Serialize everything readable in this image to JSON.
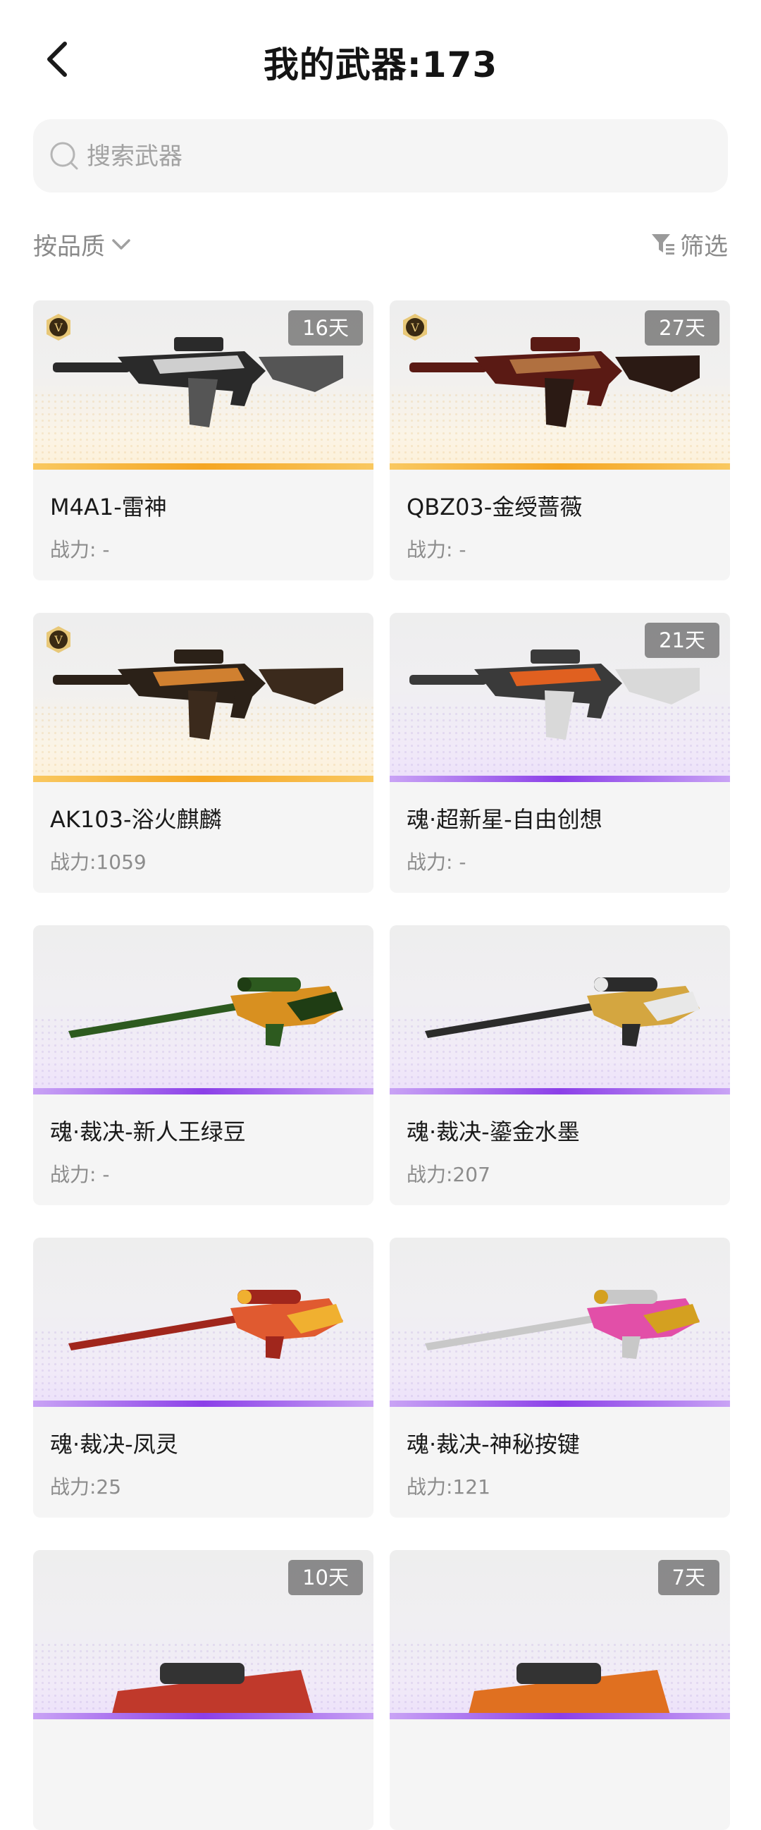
{
  "header": {
    "title": "我的武器:173"
  },
  "search": {
    "placeholder": "搜索武器"
  },
  "toolbar": {
    "sort_label": "按品质",
    "filter_label": "筛选"
  },
  "colors": {
    "gold_rarity": "#f5a623",
    "purple_rarity": "#8b3fe8",
    "card_bg": "#f5f5f5",
    "badge_bg": "#646464"
  },
  "weapons": [
    {
      "name": "M4A1-雷神",
      "power": "战力: -",
      "days": "16天",
      "v_badge": true,
      "rarity": "gold",
      "type": "rifle",
      "icon": "m4a1-thor-image"
    },
    {
      "name": "QBZ03-金绶蔷薇",
      "power": "战力: -",
      "days": "27天",
      "v_badge": true,
      "rarity": "gold",
      "type": "rifle",
      "icon": "qbz03-rose-image"
    },
    {
      "name": "AK103-浴火麒麟",
      "power": "战力:1059",
      "days": "",
      "v_badge": true,
      "rarity": "gold",
      "type": "rifle",
      "icon": "ak103-qilin-image"
    },
    {
      "name": "魂·超新星-自由创想",
      "power": "战力: -",
      "days": "21天",
      "v_badge": false,
      "rarity": "purple",
      "type": "rifle",
      "icon": "supernova-image"
    },
    {
      "name": "魂·裁决-新人王绿豆",
      "power": "战力: -",
      "days": "",
      "v_badge": false,
      "rarity": "purple",
      "type": "sniper",
      "icon": "awm-green-image"
    },
    {
      "name": "魂·裁决-鎏金水墨",
      "power": "战力:207",
      "days": "",
      "v_badge": false,
      "rarity": "purple",
      "type": "sniper",
      "icon": "awm-gold-ink-image"
    },
    {
      "name": "魂·裁决-凤灵",
      "power": "战力:25",
      "days": "",
      "v_badge": false,
      "rarity": "purple",
      "type": "sniper",
      "icon": "awm-phoenix-image"
    },
    {
      "name": "魂·裁决-神秘按键",
      "power": "战力:121",
      "days": "",
      "v_badge": false,
      "rarity": "purple",
      "type": "sniper",
      "icon": "awm-mystic-image"
    },
    {
      "name": "",
      "power": "",
      "days": "10天",
      "v_badge": false,
      "rarity": "purple",
      "type": "partial",
      "icon": "weapon-image"
    },
    {
      "name": "",
      "power": "",
      "days": "7天",
      "v_badge": false,
      "rarity": "purple",
      "type": "partial",
      "icon": "weapon-image"
    }
  ]
}
